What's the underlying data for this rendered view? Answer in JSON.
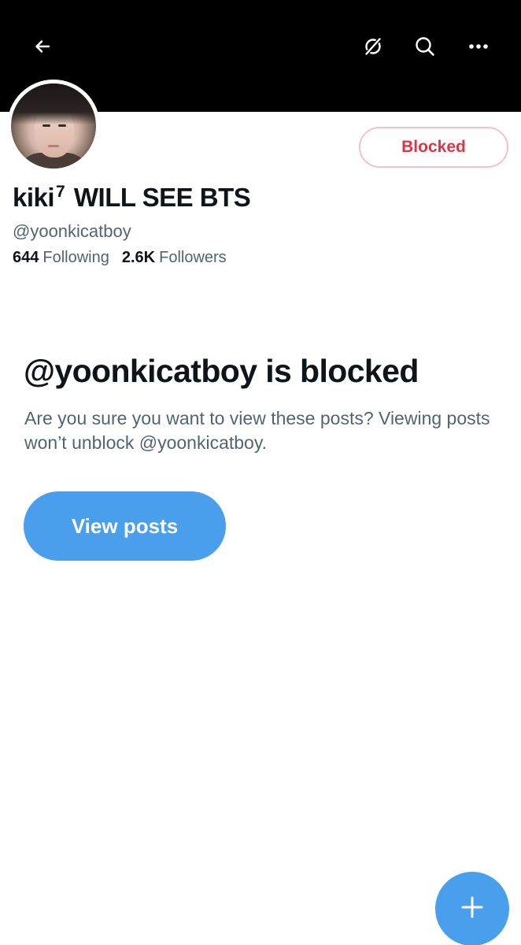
{
  "header": {
    "back_icon": "arrow-left-icon",
    "grok_icon": "grok-icon",
    "search_icon": "search-icon",
    "more_icon": "more-horizontal-icon",
    "banner_color": "#000000"
  },
  "profile": {
    "avatar": "profile-photo",
    "name_main": "kiki",
    "name_superscript": "7",
    "name_rest": "WILL SEE BTS",
    "handle": "@yoonkicatboy",
    "following_count": "644",
    "following_label": "Following",
    "followers_count": "2.6K",
    "followers_label": "Followers",
    "blocked_button_label": "Blocked"
  },
  "blocked_notice": {
    "title": "@yoonkicatboy is blocked",
    "description": "Are you sure you want to view these posts? Viewing posts won’t unblock @yoonkicatboy.",
    "view_posts_label": "View posts"
  },
  "fab": {
    "icon": "plus-icon"
  },
  "colors": {
    "accent": "#4a9fed",
    "blocked_red": "#dc3545",
    "secondary_text": "#536471"
  }
}
